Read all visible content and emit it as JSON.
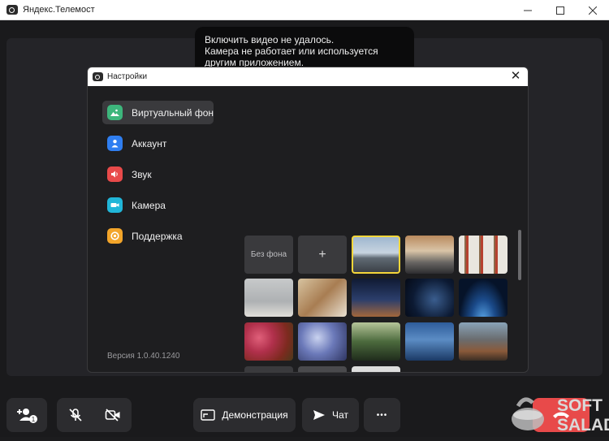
{
  "window": {
    "title": "Яндекс.Телемост"
  },
  "toast": {
    "lines": [
      "Включить видео не удалось.",
      "Камера не работает или используется",
      "другим приложением."
    ]
  },
  "settings": {
    "title": "Настройки",
    "menu": [
      {
        "label": "Виртуальный фон",
        "icon": "image-icon",
        "color": "#3db67c"
      },
      {
        "label": "Аккаунт",
        "icon": "user-icon",
        "color": "#2f7ef0"
      },
      {
        "label": "Звук",
        "icon": "speaker-icon",
        "color": "#e84a4a"
      },
      {
        "label": "Камера",
        "icon": "camera-icon",
        "color": "#21b6d8"
      },
      {
        "label": "Поддержка",
        "icon": "lifebuoy-icon",
        "color": "#f3a52a"
      }
    ],
    "version": "Версия 1.0.40.1240",
    "backgrounds": {
      "no_background": "Без фона",
      "add": "+"
    }
  },
  "toolbar": {
    "demo_label": "Демонстрация",
    "chat_label": "Чат",
    "more": "•••",
    "participants_badge": "1"
  },
  "watermark": {
    "text1": "SOFT",
    "text2": "SALAD"
  },
  "colors": {
    "accent_selected": "#f5d63a",
    "end_call": "#e84a4a"
  }
}
